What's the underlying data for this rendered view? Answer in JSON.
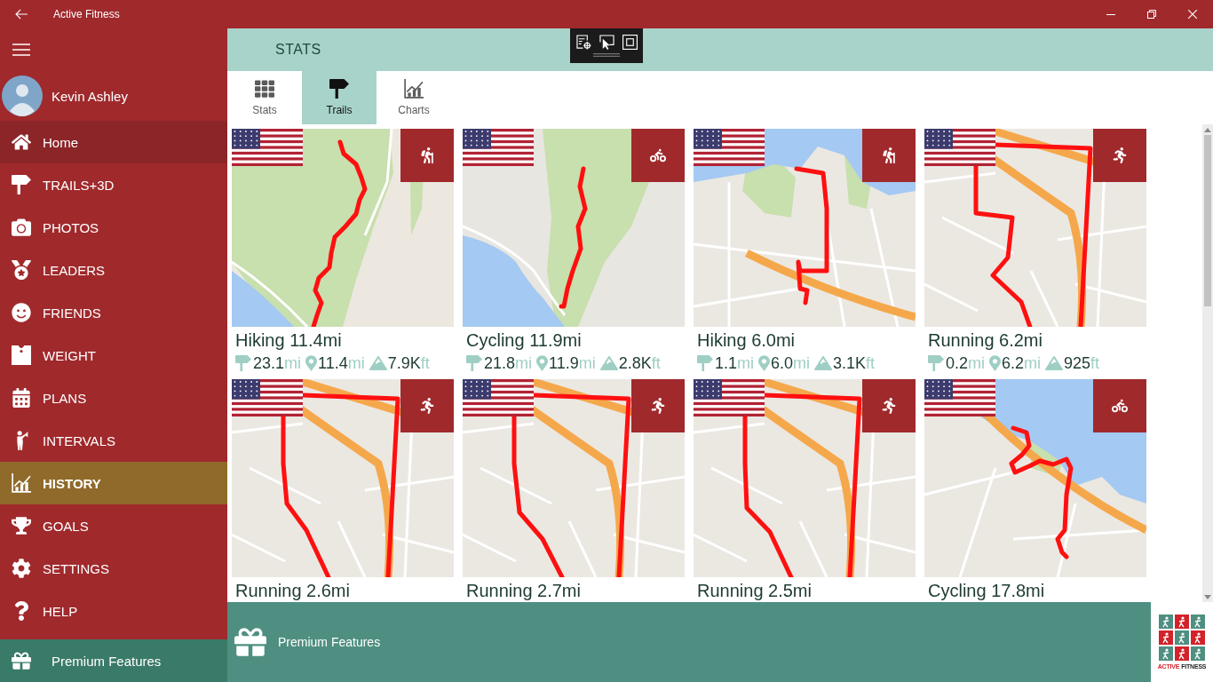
{
  "window": {
    "title": "Active Fitness"
  },
  "sidebar": {
    "user": {
      "name": "Kevin Ashley"
    },
    "items": [
      {
        "label": "Home",
        "selected": false,
        "hovered": true
      },
      {
        "label": "TRAILS+3D",
        "selected": false,
        "hovered": false
      },
      {
        "label": "PHOTOS",
        "selected": false,
        "hovered": false
      },
      {
        "label": "LEADERS",
        "selected": false,
        "hovered": false
      },
      {
        "label": "FRIENDS",
        "selected": false,
        "hovered": false
      },
      {
        "label": "WEIGHT",
        "selected": false,
        "hovered": false
      },
      {
        "label": "PLANS",
        "selected": false,
        "hovered": false
      },
      {
        "label": "INTERVALS",
        "selected": false,
        "hovered": false
      },
      {
        "label": "HISTORY",
        "selected": true,
        "hovered": false
      },
      {
        "label": "GOALS",
        "selected": false,
        "hovered": false
      },
      {
        "label": "SETTINGS",
        "selected": false,
        "hovered": false
      },
      {
        "label": "HELP",
        "selected": false,
        "hovered": false
      }
    ],
    "footer": {
      "label": "Premium Features"
    }
  },
  "header": {
    "title": "STATS"
  },
  "tabs": [
    {
      "label": "Stats",
      "selected": false
    },
    {
      "label": "Trails",
      "selected": true
    },
    {
      "label": "Charts",
      "selected": false
    }
  ],
  "trails": [
    {
      "title": "Hiking 11.4mi",
      "kind": "hiking",
      "stats": [
        {
          "value": "23.1",
          "unit": "mi"
        },
        {
          "value": "11.4",
          "unit": "mi"
        },
        {
          "value": "7.9K",
          "unit": "ft"
        }
      ]
    },
    {
      "title": "Cycling 11.9mi",
      "kind": "cycling",
      "stats": [
        {
          "value": "21.8",
          "unit": "mi"
        },
        {
          "value": "11.9",
          "unit": "mi"
        },
        {
          "value": "2.8K",
          "unit": "ft"
        }
      ]
    },
    {
      "title": "Hiking 6.0mi",
      "kind": "hiking",
      "stats": [
        {
          "value": "1.1",
          "unit": "mi"
        },
        {
          "value": "6.0",
          "unit": "mi"
        },
        {
          "value": "3.1K",
          "unit": "ft"
        }
      ]
    },
    {
      "title": "Running 6.2mi",
      "kind": "running",
      "stats": [
        {
          "value": "0.2",
          "unit": "mi"
        },
        {
          "value": "6.2",
          "unit": "mi"
        },
        {
          "value": "925",
          "unit": "ft"
        }
      ]
    },
    {
      "title": "Running 2.6mi",
      "kind": "running"
    },
    {
      "title": "Running 2.7mi",
      "kind": "running"
    },
    {
      "title": "Running 2.5mi",
      "kind": "running"
    },
    {
      "title": "Cycling 17.8mi",
      "kind": "cycling"
    }
  ],
  "banner": {
    "label": "Premium Features"
  },
  "logo": {
    "words": [
      "ACTIVE",
      "FITNESS"
    ]
  }
}
